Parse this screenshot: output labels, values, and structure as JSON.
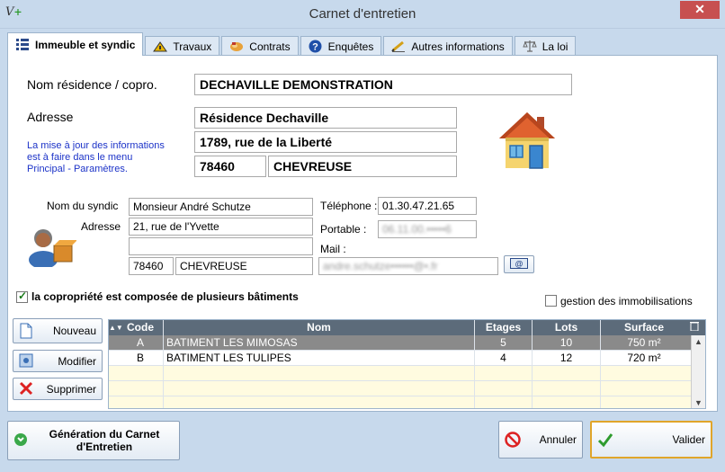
{
  "window": {
    "title": "Carnet d'entretien",
    "close": "✕"
  },
  "tabs": [
    {
      "label": "Immeuble et syndic",
      "icon": "grid-icon"
    },
    {
      "label": "Travaux",
      "icon": "construction-icon"
    },
    {
      "label": "Contrats",
      "icon": "handshake-icon"
    },
    {
      "label": "Enquêtes",
      "icon": "help-icon"
    },
    {
      "label": "Autres informations",
      "icon": "pencil-icon"
    },
    {
      "label": "La loi",
      "icon": "scales-icon"
    }
  ],
  "residence": {
    "name_label": "Nom résidence / copro.",
    "name": "DECHAVILLE DEMONSTRATION",
    "address_label": "Adresse",
    "address_line1": "Résidence Dechaville",
    "address_line2": "1789, rue de la Liberté",
    "postcode": "78460",
    "city": "CHEVREUSE",
    "note": "La mise à jour des informations est à faire dans le menu Principal - Paramètres."
  },
  "syndic": {
    "name_label": "Nom du syndic",
    "name": "Monsieur André Schutze",
    "address_label": "Adresse",
    "address_line1": "21, rue de l'Yvette",
    "address_line2": "",
    "postcode": "78460",
    "city": "CHEVREUSE",
    "phone_label": "Téléphone :",
    "phone": "01.30.47.21.65",
    "mobile_label": "Portable :",
    "mobile": "06.11.00.•••••6",
    "mail_label": "Mail :",
    "mail": "andre.schutze••••••@•.fr"
  },
  "options": {
    "multi_buildings_label": "la copropriété est composée de plusieurs bâtiments",
    "multi_buildings_checked": true,
    "immobilisations_label": "gestion des immobilisations",
    "immobilisations_checked": false
  },
  "buttons": {
    "new": "Nouveau",
    "edit": "Modifier",
    "delete": "Supprimer",
    "generate": "Génération du Carnet d'Entretien",
    "cancel": "Annuler",
    "validate": "Valider"
  },
  "buildings": {
    "columns": {
      "code": "Code",
      "nom": "Nom",
      "etages": "Etages",
      "lots": "Lots",
      "surface": "Surface"
    },
    "rows": [
      {
        "code": "A",
        "nom": "BATIMENT LES MIMOSAS",
        "etages": "5",
        "lots": "10",
        "surface": "750 m²"
      },
      {
        "code": "B",
        "nom": "BATIMENT LES TULIPES",
        "etages": "4",
        "lots": "12",
        "surface": "720 m²"
      }
    ]
  },
  "colors": {
    "accent": "#1c33c8",
    "grid_header": "#5c6b7a",
    "selected_row": "#8a8a8a",
    "empty_row": "#fffbe0",
    "window_bg": "#c7d9ec"
  }
}
